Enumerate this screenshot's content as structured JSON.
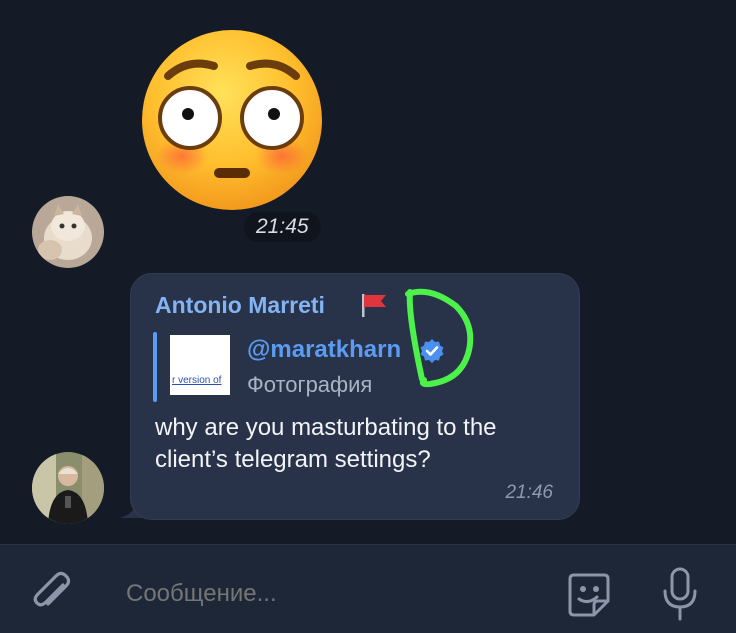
{
  "sticker": {
    "emoji": "flushed-face",
    "time": "21:45"
  },
  "message": {
    "sender": "Antonio Marreti",
    "reply": {
      "name": "@maratkharn",
      "subtitle": "Фотография",
      "thumb_text": "r version of"
    },
    "text": "why are you masturbating to the client’s telegram settings?",
    "time": "21:46"
  },
  "input": {
    "placeholder": "Сообщение..."
  },
  "icons": {
    "attach": "paperclip-icon",
    "sticker": "sticker-face-icon",
    "mic": "microphone-icon",
    "flag": "red-flag-icon",
    "verified": "verified-badge-icon"
  },
  "colors": {
    "background": "#141a26",
    "bubble": "#283248",
    "accent": "#5b9cf2",
    "sender": "#82b4f5",
    "scribble": "#4cf24a"
  }
}
